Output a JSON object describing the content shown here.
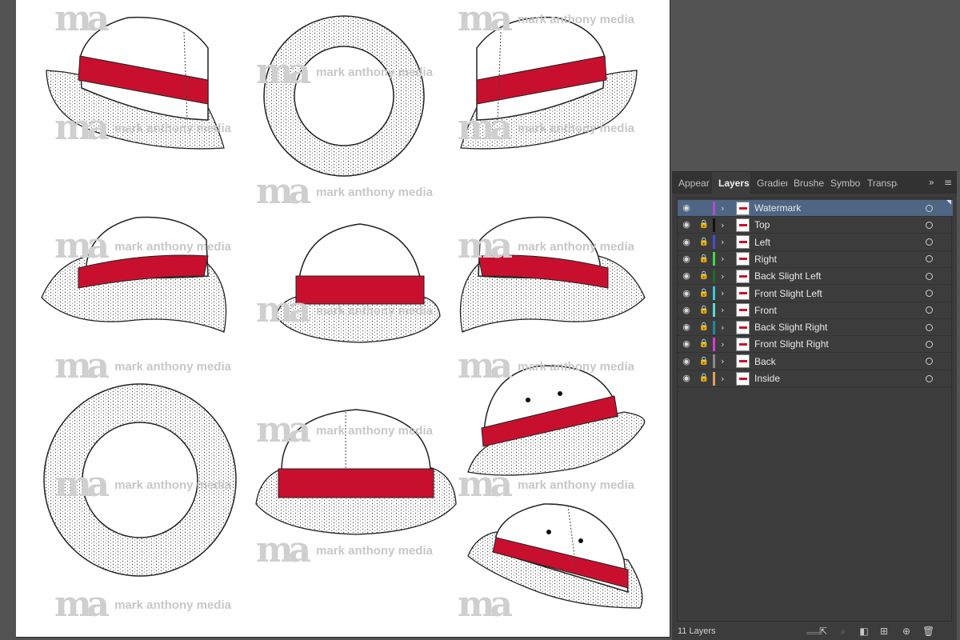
{
  "watermark": {
    "logo": "ma",
    "text": "mark anthony media"
  },
  "panel": {
    "tabs": [
      {
        "label": "Appear",
        "active": false
      },
      {
        "label": "Layers",
        "active": true
      },
      {
        "label": "Gradier",
        "active": false
      },
      {
        "label": "Brushe:",
        "active": false
      },
      {
        "label": "Symbol",
        "active": false
      },
      {
        "label": "Transpa",
        "active": false
      }
    ],
    "overflow_icon": "double-chevron-right-icon",
    "menu_icon": "hamburger-menu-icon",
    "layers": [
      {
        "name": "Watermark",
        "color": "#b04ad0",
        "selected": true,
        "locked": false
      },
      {
        "name": "Top",
        "color": "#111111",
        "selected": false,
        "locked": true
      },
      {
        "name": "Left",
        "color": "#4a4ad8",
        "selected": false,
        "locked": true
      },
      {
        "name": "Right",
        "color": "#3ed84a",
        "selected": false,
        "locked": true
      },
      {
        "name": "Back Slight Left",
        "color": "#1f6b2a",
        "selected": false,
        "locked": true
      },
      {
        "name": "Front Slight Left",
        "color": "#36c8d8",
        "selected": false,
        "locked": true
      },
      {
        "name": "Front",
        "color": "#5ad8d8",
        "selected": false,
        "locked": true
      },
      {
        "name": "Back Slight Right",
        "color": "#1e8a9a",
        "selected": false,
        "locked": true
      },
      {
        "name": "Front Slight Right",
        "color": "#d83ad0",
        "selected": false,
        "locked": true
      },
      {
        "name": "Back",
        "color": "#8a8a8a",
        "selected": false,
        "locked": true
      },
      {
        "name": "Inside",
        "color": "#e0a060",
        "selected": false,
        "locked": true
      }
    ],
    "footer": {
      "count_label": "11 Layers",
      "icons": [
        "export-icon",
        "search-icon",
        "clipping-mask-icon",
        "new-sublayer-icon",
        "new-layer-icon",
        "trash-icon"
      ]
    }
  },
  "colors": {
    "band_red": "#c8102e",
    "selection": "#4e6683",
    "panel_bg": "#3c3c3c",
    "workspace_bg": "#535353"
  }
}
